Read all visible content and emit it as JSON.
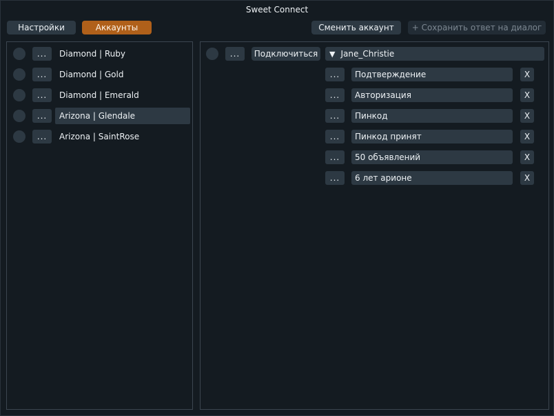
{
  "window": {
    "title": "Sweet Connect"
  },
  "topbar": {
    "settings_label": "Настройки",
    "accounts_label": "Аккаунты",
    "switch_account_label": "Сменить аккаунт",
    "save_reply_label": "+ Сохранить ответ на диалог"
  },
  "accounts": {
    "items": [
      {
        "dots": "...",
        "label": "Diamond | Ruby",
        "selected": false
      },
      {
        "dots": "...",
        "label": "Diamond | Gold",
        "selected": false
      },
      {
        "dots": "...",
        "label": "Diamond | Emerald",
        "selected": false
      },
      {
        "dots": "...",
        "label": "Arizona | Glendale",
        "selected": true
      },
      {
        "dots": "...",
        "label": "Arizona | SaintRose",
        "selected": false
      }
    ]
  },
  "detail": {
    "dots": "...",
    "connect_label": "Подключиться",
    "dropdown_arrow": "▼",
    "character_name": "Jane_Christie",
    "replies": [
      {
        "dots": "...",
        "text": "Подтверждение",
        "remove": "X"
      },
      {
        "dots": "...",
        "text": "Авторизация",
        "remove": "X"
      },
      {
        "dots": "...",
        "text": "Пинкод",
        "remove": "X"
      },
      {
        "dots": "...",
        "text": "Пинкод принят",
        "remove": "X"
      },
      {
        "dots": "...",
        "text": "50 объявлений",
        "remove": "X"
      },
      {
        "dots": "...",
        "text": "6 лет арионе",
        "remove": "X"
      }
    ]
  },
  "colors": {
    "background": "#141b21",
    "control": "#2d3943",
    "accent": "#b0601a",
    "border": "#3c4650",
    "text": "#eef2f5"
  }
}
